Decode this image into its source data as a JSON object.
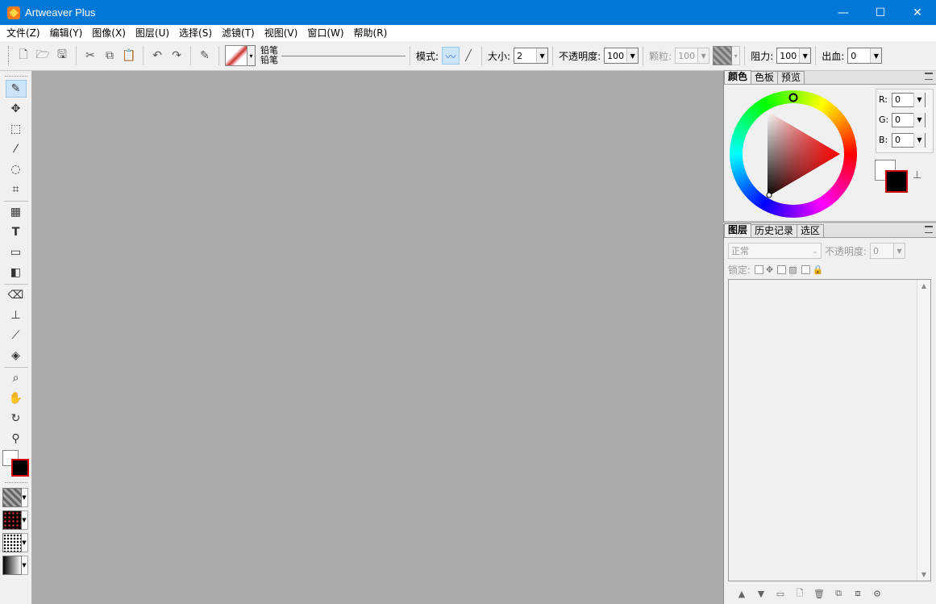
{
  "window": {
    "title": "Artweaver Plus",
    "controls": [
      "—",
      "☐",
      "✕"
    ]
  },
  "menu": [
    "文件(Z)",
    "编辑(Y)",
    "图像(X)",
    "图层(U)",
    "选择(S)",
    "滤镜(T)",
    "视图(V)",
    "窗口(W)",
    "帮助(R)"
  ],
  "toolbar": {
    "brush_category": "铅笔",
    "brush_variant": "铅笔",
    "mode_label": "模式:",
    "size_label": "大小:",
    "size_value": "2",
    "opacity_label": "不透明度:",
    "opacity_value": "100",
    "grain_label": "颗粒:",
    "grain_value": "100",
    "resist_label": "阻力:",
    "resist_value": "100",
    "bleed_label": "出血:",
    "bleed_value": "0"
  },
  "color_panel": {
    "tabs": [
      "颜色",
      "色板",
      "预览"
    ],
    "active_tab": 0,
    "r_label": "R:",
    "r_value": "0",
    "g_label": "G:",
    "g_value": "0",
    "b_label": "B:",
    "b_value": "0",
    "foreground_color": "#000000",
    "background_color": "#ffffff"
  },
  "layers_panel": {
    "tabs": [
      "图层",
      "历史记录",
      "选区"
    ],
    "active_tab": 0,
    "blend_mode": "正常",
    "opacity_label": "不透明度:",
    "opacity_value": "0",
    "lock_label": "锁定:"
  },
  "colors": {
    "titlebar": "#0078d7",
    "canvas": "#ababab",
    "accent_red": "#cc0000"
  }
}
